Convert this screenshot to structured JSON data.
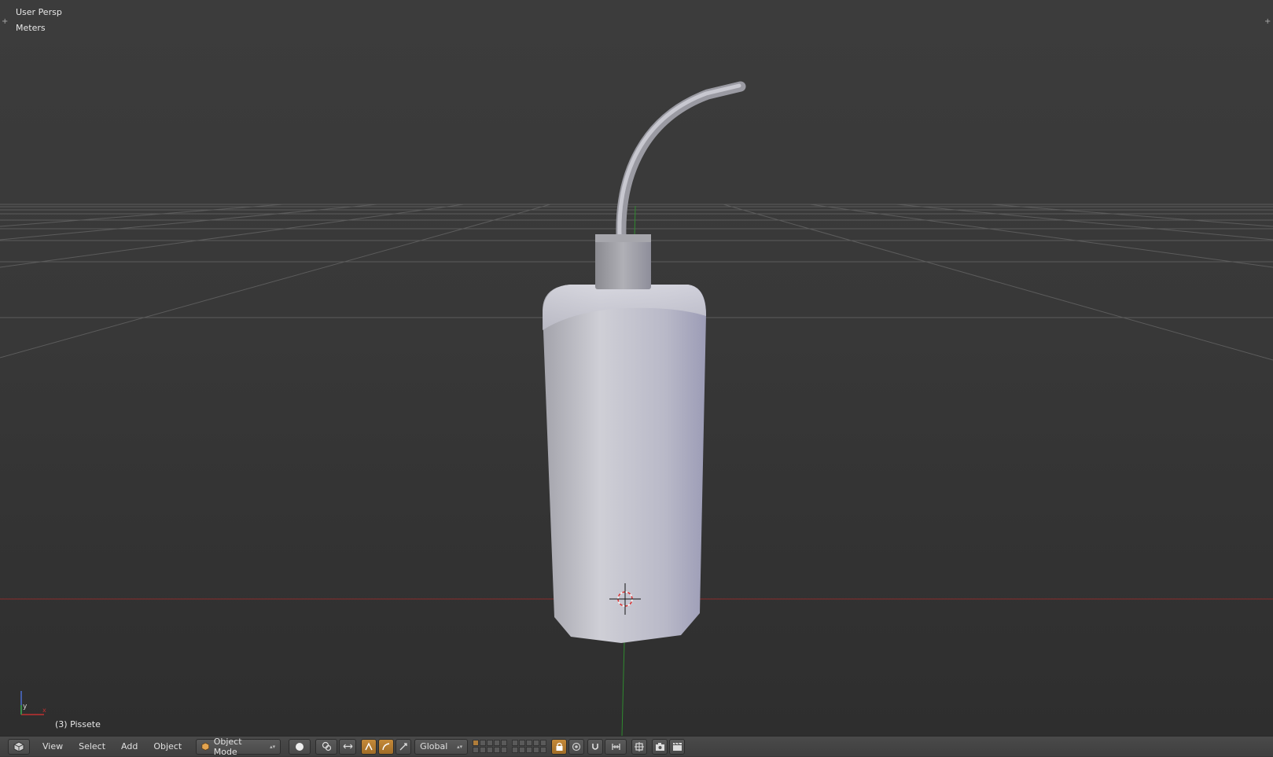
{
  "viewport": {
    "view_label": "User Persp",
    "units_label": "Meters",
    "object_info": "(3) Pissete",
    "corner_plus": "+"
  },
  "header": {
    "editor_type_icon": "3d-view-icon",
    "menus": [
      "View",
      "Select",
      "Add",
      "Object"
    ],
    "mode": "Object Mode",
    "mode_icon": "cube-icon",
    "shading_icon": "solid-sphere-icon",
    "pivot_icon": "pivot-icon",
    "manipulator_icon": "manipulator-icon",
    "orientation": "Global",
    "arrows": "▴▾"
  },
  "gizmo": {
    "y_label": "y",
    "x_label": "x"
  },
  "colors": {
    "x_axis": "#b03636",
    "y_axis": "#3a9a3a",
    "object": "#b8b8c6",
    "active_button": "#b07d3a"
  }
}
